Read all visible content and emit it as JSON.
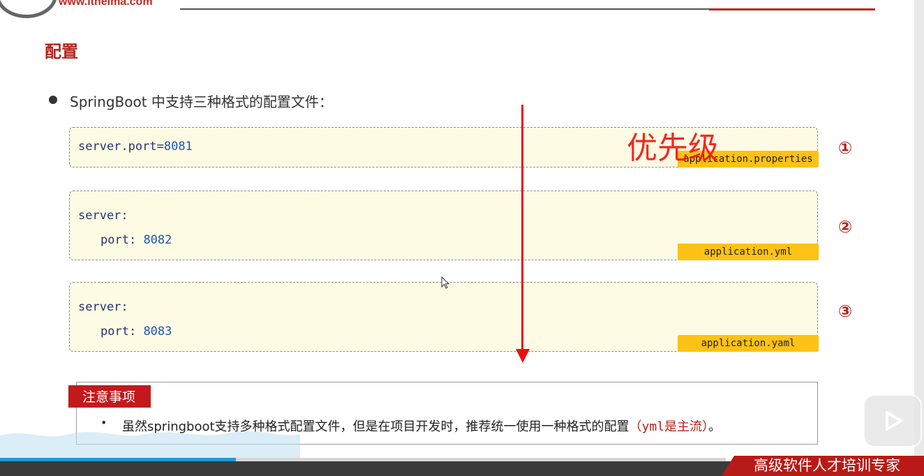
{
  "header": {
    "site_url": "www.itheima.com"
  },
  "slide": {
    "title": "配置",
    "bullet": "SpringBoot 中支持三种格式的配置文件：",
    "priority_label": "优先级",
    "configs": [
      {
        "number": "①",
        "lines": [
          {
            "key": "server.port",
            "sep": "=",
            "value": "8081"
          }
        ],
        "filename": "application.properties"
      },
      {
        "number": "②",
        "lines": [
          {
            "key": "server",
            "sep": ":",
            "value": ""
          },
          {
            "key": "port",
            "sep": ": ",
            "value": "8082"
          }
        ],
        "filename": "application.yml"
      },
      {
        "number": "③",
        "lines": [
          {
            "key": "server",
            "sep": ":",
            "value": ""
          },
          {
            "key": "port",
            "sep": ": ",
            "value": "8083"
          }
        ],
        "filename": "application.yaml"
      }
    ],
    "note": {
      "label": "注意事项",
      "bullet": "•",
      "text": "虽然springboot支持多种格式配置文件，但是在项目开发时，推荐统一使用一种格式的配置",
      "emphasis": "（yml是主流）",
      "end": "。"
    }
  },
  "player": {
    "progress": 0.325,
    "brand": "高级软件人才培训专家",
    "play_icon": "play-icon"
  },
  "colors": {
    "accent_red": "#c0281f",
    "tag_yellow": "#fdc215",
    "code_bg": "#fefbe5",
    "progress_blue": "#1e9bd7"
  }
}
